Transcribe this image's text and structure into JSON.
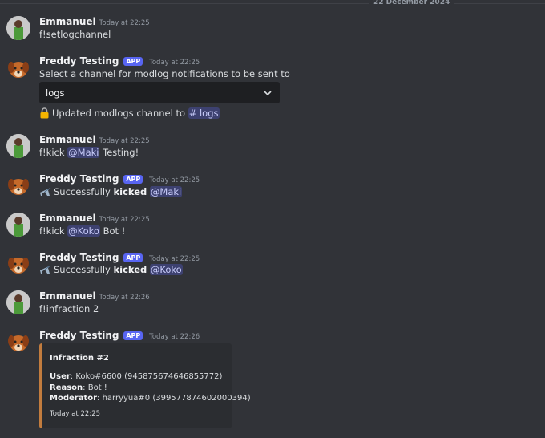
{
  "divider_date": "22 December 2024",
  "messages": [
    {
      "author": "Emmanuel",
      "time": "Today at 22:25",
      "text": "f!setlogchannel"
    },
    {
      "author": "Freddy Testing",
      "badge": "APP",
      "time": "Today at 22:25",
      "text": "Select a channel for modlog notifications to be sent to",
      "select_value": "logs",
      "followup_prefix": "Updated modlogs channel to",
      "followup_channel": "# logs",
      "followup_icon": "lock-icon"
    },
    {
      "author": "Emmanuel",
      "time": "Today at 22:25",
      "cmd": "f!kick",
      "mention": "@Maki",
      "suffix": "Testing!"
    },
    {
      "author": "Freddy Testing",
      "badge": "APP",
      "time": "Today at 22:25",
      "prefix": "Successfully",
      "bold": "kicked",
      "mention": "@Maki",
      "icon": "airplane-icon"
    },
    {
      "author": "Emmanuel",
      "time": "Today at 22:25",
      "cmd": "f!kick",
      "mention": "@Koko",
      "suffix": "Bot !"
    },
    {
      "author": "Freddy Testing",
      "badge": "APP",
      "time": "Today at 22:25",
      "prefix": "Successfully",
      "bold": "kicked",
      "mention": "@Koko",
      "icon": "airplane-icon"
    },
    {
      "author": "Emmanuel",
      "time": "Today at 22:26",
      "text": "f!infraction 2"
    },
    {
      "author": "Freddy Testing",
      "badge": "APP",
      "time": "Today at 22:26"
    }
  ],
  "embed": {
    "title": "Infraction #2",
    "user_label": "User",
    "user_value": ": Koko#6600 (945875674646855772)",
    "reason_label": "Reason",
    "reason_value": ": Bot !",
    "moderator_label": "Moderator",
    "moderator_value": ": harryyua#0 (399577874602000394)",
    "footer": "Today at 22:25",
    "accent_color": "#c27c3e"
  },
  "colors": {
    "background": "#313338",
    "mention_bg": "#3c4270",
    "badge": "#5865f2"
  }
}
